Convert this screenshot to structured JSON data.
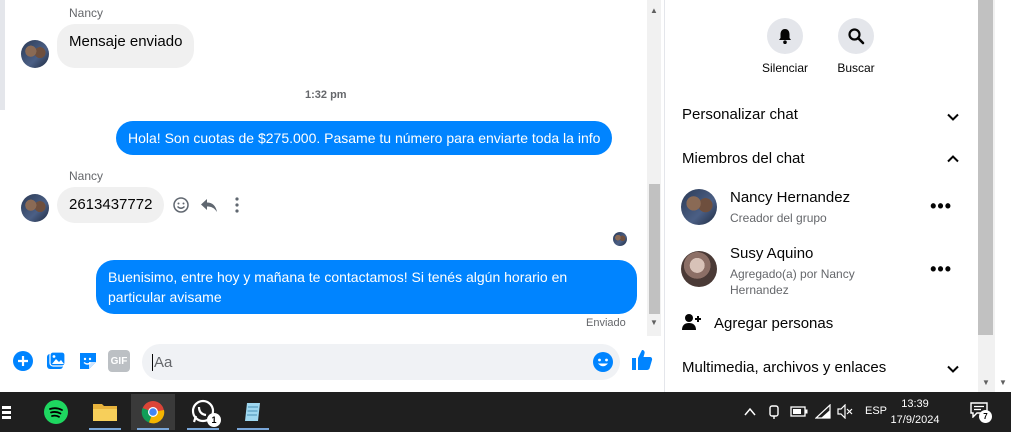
{
  "messages": {
    "sender_top": "Nancy",
    "msg1": "Mensaje enviado",
    "time": "1:32 pm",
    "out1": "Hola! Son cuotas de $275.000. Pasame tu número para enviarte toda la info",
    "sender_mid": "Nancy",
    "msg2": "2613437772",
    "out2": "Buenisimo, entre hoy y mañana te contactamos! Si tenés algún horario en particular avisame",
    "status": "Enviado"
  },
  "composer": {
    "placeholder": "Aa",
    "gif_label": "GIF"
  },
  "right_panel": {
    "mute_label": "Silenciar",
    "search_label": "Buscar",
    "customize": "Personalizar chat",
    "members": "Miembros del chat",
    "member1": {
      "name": "Nancy Hernandez",
      "sub": "Creador del grupo"
    },
    "member2": {
      "name": "Susy Aquino",
      "sub": "Agregado(a) por Nancy Hernandez"
    },
    "add_people": "Agregar personas",
    "media": "Multimedia, archivos y enlaces"
  },
  "taskbar": {
    "whatsapp_badge": "1",
    "language": "ESP",
    "time": "13:39",
    "date": "17/9/2024",
    "notifications": "7"
  },
  "colors": {
    "messenger_blue": "#0084ff",
    "bubble_gray": "#f0f0f0",
    "taskbar": "#1f1f1f"
  }
}
